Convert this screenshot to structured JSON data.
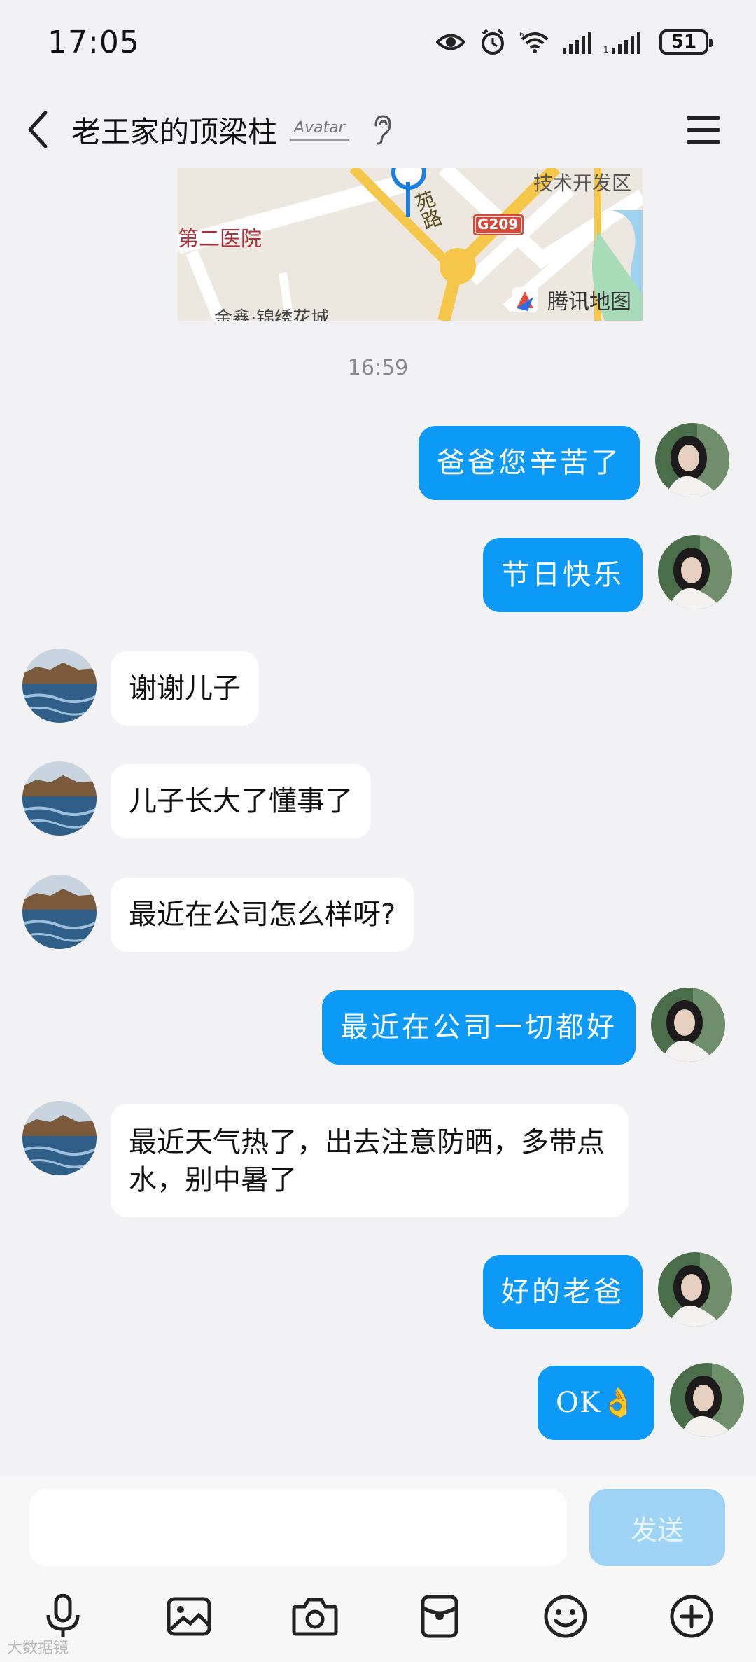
{
  "status_bar": {
    "time": "17:05",
    "network": "6",
    "battery": "51"
  },
  "header": {
    "title": "老王家的顶梁柱",
    "badge": "Avatar"
  },
  "map": {
    "labels": [
      "技术开发区",
      "第二医院",
      "苑路",
      "G209",
      "金鑫·锦绣花城"
    ],
    "brand": "腾讯地图"
  },
  "timestamp": "16:59",
  "messages": [
    {
      "side": "out",
      "text": "爸爸您辛苦了"
    },
    {
      "side": "out",
      "text": "节日快乐"
    },
    {
      "side": "in",
      "text": "谢谢儿子"
    },
    {
      "side": "in",
      "text": "儿子长大了懂事了"
    },
    {
      "side": "in",
      "text": "最近在公司怎么样呀?"
    },
    {
      "side": "out",
      "text": "最近在公司一切都好"
    },
    {
      "side": "in",
      "text": "最近天气热了，出去注意防晒，多带点水，别中暑了"
    },
    {
      "side": "out",
      "text": "好的老爸"
    },
    {
      "side": "out",
      "text": "OK👌"
    }
  ],
  "input": {
    "placeholder": "",
    "send_label": "发送"
  },
  "toolbar": [
    "microphone-icon",
    "image-icon",
    "camera-icon",
    "red-packet-icon",
    "emoji-icon",
    "plus-icon"
  ],
  "watermark": "大数据镜"
}
